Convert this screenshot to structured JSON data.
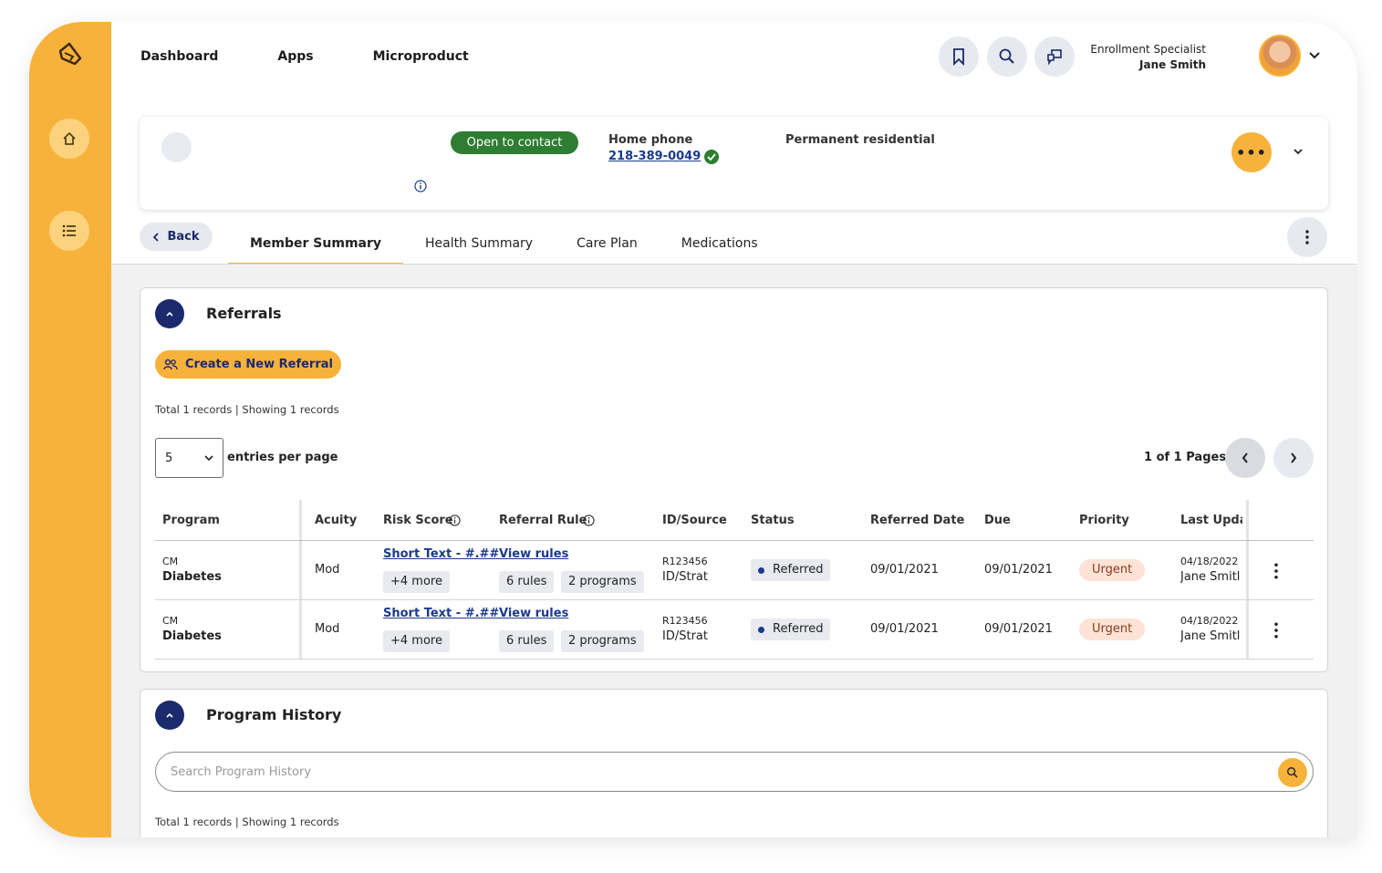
{
  "nav": {
    "dashboard": "Dashboard",
    "apps": "Apps",
    "microproduct": "Microproduct"
  },
  "header_icons": [
    "bookmark-icon",
    "search-icon",
    "chat-icon"
  ],
  "user": {
    "role": "Enrollment Specialist",
    "name": "Jane Smith"
  },
  "member": {
    "contact_status": "Open to contact",
    "phone_label": "Home phone",
    "phone": "218-389-0049",
    "residence": "Permanent residential",
    "more": "•••"
  },
  "tabs": {
    "back": "Back",
    "items": [
      "Member Summary",
      "Health Summary",
      "Care Plan",
      "Medications"
    ],
    "active": "Member Summary"
  },
  "referrals": {
    "title": "Referrals",
    "create_label": "Create a New Referral",
    "records_info": "Total 1 records  |  Showing 1 records",
    "per_page_value": "5",
    "per_page_label": "entries per page",
    "pages": "1 of 1 Pages",
    "columns": [
      "Program",
      "Acuity",
      "Risk Score",
      "Referral Rule",
      "ID/Source",
      "Status",
      "Referred Date",
      "Due",
      "Priority",
      "Last Upda"
    ],
    "rows": [
      {
        "program_code": "CM",
        "program_name": "Diabetes",
        "acuity": "Mod",
        "risk_link": "Short Text - #.##",
        "risk_more": "+4 more",
        "rule_link": "View rules",
        "rule_count": "6 rules",
        "rule_programs": "2 programs",
        "id": "R123456",
        "source": "ID/Strat",
        "status": "Referred",
        "referred_date": "09/01/2021",
        "due": "09/01/2021",
        "priority": "Urgent",
        "last_update_date": "04/18/2022",
        "last_update_by": "Jane Smitl"
      },
      {
        "program_code": "CM",
        "program_name": "Diabetes",
        "acuity": "Mod",
        "risk_link": "Short Text - #.##",
        "risk_more": "+4 more",
        "rule_link": "View rules",
        "rule_count": "6 rules",
        "rule_programs": "2 programs",
        "id": "R123456",
        "source": "ID/Strat",
        "status": "Referred",
        "referred_date": "09/01/2021",
        "due": "09/01/2021",
        "priority": "Urgent",
        "last_update_date": "04/18/2022",
        "last_update_by": "Jane Smitl"
      }
    ]
  },
  "program_history": {
    "title": "Program History",
    "search_placeholder": "Search Program History",
    "records_info": "Total 1 records  |  Showing 1 records"
  },
  "colors": {
    "accent": "#f7b23b",
    "navy": "#1a2a6c",
    "success": "#2e7d32",
    "urgent_bg": "#fde3d6"
  }
}
